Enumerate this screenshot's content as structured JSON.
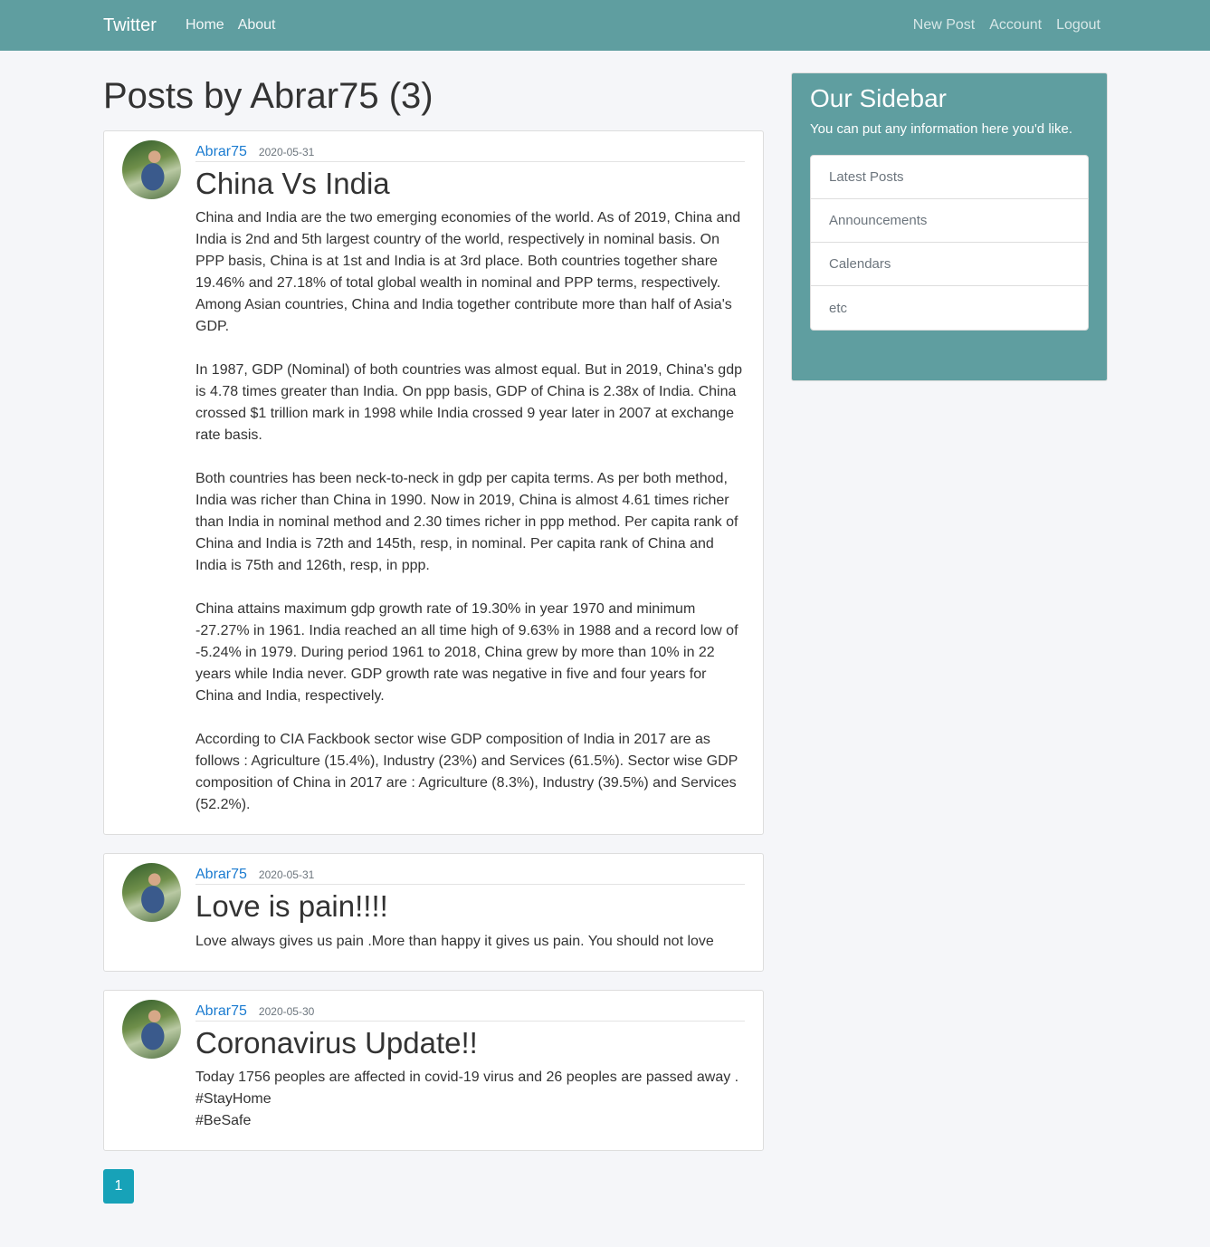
{
  "navbar": {
    "brand": "Twitter",
    "left_links": [
      "Home",
      "About"
    ],
    "right_links": [
      "New Post",
      "Account",
      "Logout"
    ]
  },
  "page_title": "Posts by Abrar75 (3)",
  "posts": [
    {
      "author": "Abrar75",
      "date": "2020-05-31",
      "title": "China Vs India",
      "content": "China and India are the two emerging economies of the world. As of 2019, China and India is 2nd and 5th largest country of the world, respectively in nominal basis. On PPP basis, China is at 1st and India is at 3rd place. Both countries together share 19.46% and 27.18% of total global wealth in nominal and PPP terms, respectively. Among Asian countries, China and India together contribute more than half of Asia's GDP.\n\nIn 1987, GDP (Nominal) of both countries was almost equal. But in 2019, China's gdp is 4.78 times greater than India. On ppp basis, GDP of China is 2.38x of India. China crossed $1 trillion mark in 1998 while India crossed 9 year later in 2007 at exchange rate basis.\n\nBoth countries has been neck-to-neck in gdp per capita terms. As per both method, India was richer than China in 1990. Now in 2019, China is almost 4.61 times richer than India in nominal method and 2.30 times richer in ppp method. Per capita rank of China and India is 72th and 145th, resp, in nominal. Per capita rank of China and India is 75th and 126th, resp, in ppp.\n\nChina attains maximum gdp growth rate of 19.30% in year 1970 and minimum -27.27% in 1961. India reached an all time high of 9.63% in 1988 and a record low of -5.24% in 1979. During period 1961 to 2018, China grew by more than 10% in 22 years while India never. GDP growth rate was negative in five and four years for China and India, respectively.\n\nAccording to CIA Fackbook sector wise GDP composition of India in 2017 are as follows : Agriculture (15.4%), Industry (23%) and Services (61.5%). Sector wise GDP composition of China in 2017 are : Agriculture (8.3%), Industry (39.5%) and Services (52.2%)."
    },
    {
      "author": "Abrar75",
      "date": "2020-05-31",
      "title": "Love is pain!!!!",
      "content": "Love always gives us pain .More than happy it gives us pain. You should not love"
    },
    {
      "author": "Abrar75",
      "date": "2020-05-30",
      "title": "Coronavirus Update!!",
      "content": "Today 1756 peoples are affected in covid-19 virus and 26 peoples are passed away .\n#StayHome\n#BeSafe"
    }
  ],
  "pagination": {
    "current_page": "1"
  },
  "sidebar": {
    "title": "Our Sidebar",
    "description": "You can put any information here you'd like.",
    "items": [
      "Latest Posts",
      "Announcements",
      "Calendars",
      "etc"
    ]
  }
}
